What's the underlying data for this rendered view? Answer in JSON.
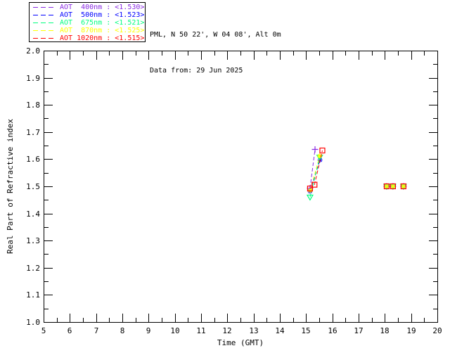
{
  "header": {
    "station_line": "PML, N 50 22', W 04 08', Alt 0m",
    "date_line": "Data from: 29 Jun 2025"
  },
  "chart_data": {
    "type": "line",
    "title": "PML, N 50 22', W 04 08', Alt 0m",
    "subtitle": "Data from: 29 Jun 2025",
    "xlabel": "Time (GMT)",
    "ylabel": "Real Part of Refractive index",
    "xlim": [
      5,
      20
    ],
    "ylim": [
      1.0,
      2.0
    ],
    "x_minor_step": 0.5,
    "y_minor_step": 0.05,
    "grid": false,
    "legend_position": "top-left-outside",
    "axis_color": "#000000",
    "background_color": "#ffffff",
    "xtick_values": [
      5,
      6,
      7,
      8,
      9,
      10,
      11,
      12,
      13,
      14,
      15,
      16,
      17,
      18,
      19,
      20
    ],
    "xtick_labels": [
      "5",
      "6",
      "7",
      "8",
      "9",
      "10",
      "11",
      "12",
      "13",
      "14",
      "15",
      "16",
      "17",
      "18",
      "19",
      "20"
    ],
    "ytick_values": [
      1.0,
      1.1,
      1.2,
      1.3,
      1.4,
      1.5,
      1.6,
      1.7,
      1.8,
      1.9,
      2.0
    ],
    "ytick_labels": [
      "1.0",
      "1.1",
      "1.2",
      "1.3",
      "1.4",
      "1.5",
      "1.6",
      "1.7",
      "1.8",
      "1.9",
      "2.0"
    ],
    "series": [
      {
        "name": "AOT 400nm",
        "wavelength": "400nm",
        "mean_value": "<1.530>",
        "legend_label": "AOT  400nm : <1.530>",
        "color": "#8a2be2",
        "marker": "plus",
        "line_points": [
          [
            15.15,
            1.493
          ],
          [
            15.34,
            1.636
          ]
        ],
        "isolated_points": [
          [
            18.07,
            1.5
          ],
          [
            18.31,
            1.5
          ],
          [
            18.71,
            1.5
          ]
        ]
      },
      {
        "name": "AOT 500nm",
        "wavelength": "500nm",
        "mean_value": "<1.523>",
        "legend_label": "AOT  500nm : <1.523>",
        "color": "#0000ff",
        "marker": "asterisk",
        "line_points": [
          [
            15.15,
            1.482
          ],
          [
            15.53,
            1.597
          ]
        ],
        "isolated_points": [
          [
            18.07,
            1.5
          ],
          [
            18.31,
            1.5
          ],
          [
            18.71,
            1.5
          ]
        ]
      },
      {
        "name": "AOT 675nm",
        "wavelength": "675nm",
        "mean_value": "<1.521>",
        "legend_label": "AOT  675nm : <1.521>",
        "color": "#00ff7f",
        "marker": "triangle-down",
        "line_points": [
          [
            15.15,
            1.46
          ],
          [
            15.52,
            1.607
          ]
        ],
        "isolated_points": [
          [
            18.07,
            1.5
          ],
          [
            18.31,
            1.5
          ],
          [
            18.71,
            1.5
          ]
        ]
      },
      {
        "name": "AOT 870nm",
        "wavelength": "870nm",
        "mean_value": "<1.525>",
        "legend_label": "AOT  870nm : <1.525>",
        "color": "#ffff00",
        "marker": "asterisk",
        "line_points": [
          [
            15.16,
            1.485
          ],
          [
            15.52,
            1.612
          ]
        ],
        "isolated_points": [
          [
            18.07,
            1.5
          ],
          [
            18.31,
            1.5
          ],
          [
            18.71,
            1.5
          ]
        ]
      },
      {
        "name": "AOT 1020nm",
        "wavelength": "1020nm",
        "mean_value": "<1.515>",
        "legend_label": "AOT 1020nm : <1.515>",
        "color": "#ff0000",
        "marker": "square",
        "line_points": [
          [
            15.15,
            1.492
          ],
          [
            15.32,
            1.506
          ],
          [
            15.62,
            1.632
          ]
        ],
        "isolated_points": [
          [
            18.07,
            1.5
          ],
          [
            18.31,
            1.5
          ],
          [
            18.71,
            1.5
          ]
        ]
      }
    ]
  }
}
